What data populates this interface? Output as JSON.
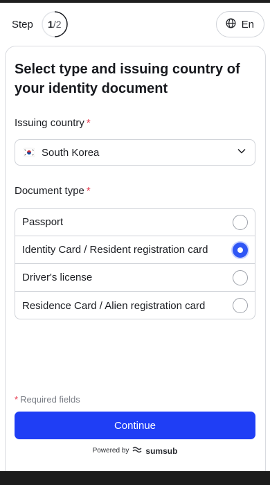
{
  "header": {
    "step_label": "Step",
    "step_current": "1",
    "step_total": "/2",
    "language": "En"
  },
  "form": {
    "title": "Select type and issuing country of your identity document",
    "country_label": "Issuing country",
    "country_value": "South Korea",
    "doc_type_label": "Document type",
    "required_marker": "*",
    "options": [
      {
        "label": "Passport",
        "selected": false
      },
      {
        "label": "Identity Card / Resident registration card",
        "selected": true
      },
      {
        "label": "Driver's license",
        "selected": false
      },
      {
        "label": "Residence Card / Alien registration card",
        "selected": false
      }
    ],
    "required_note": "Required fields",
    "continue_label": "Continue"
  },
  "footer": {
    "powered_by": "Powered by",
    "brand": "sumsub"
  },
  "colors": {
    "accent": "#1f3ef5",
    "required": "#e5364b"
  }
}
